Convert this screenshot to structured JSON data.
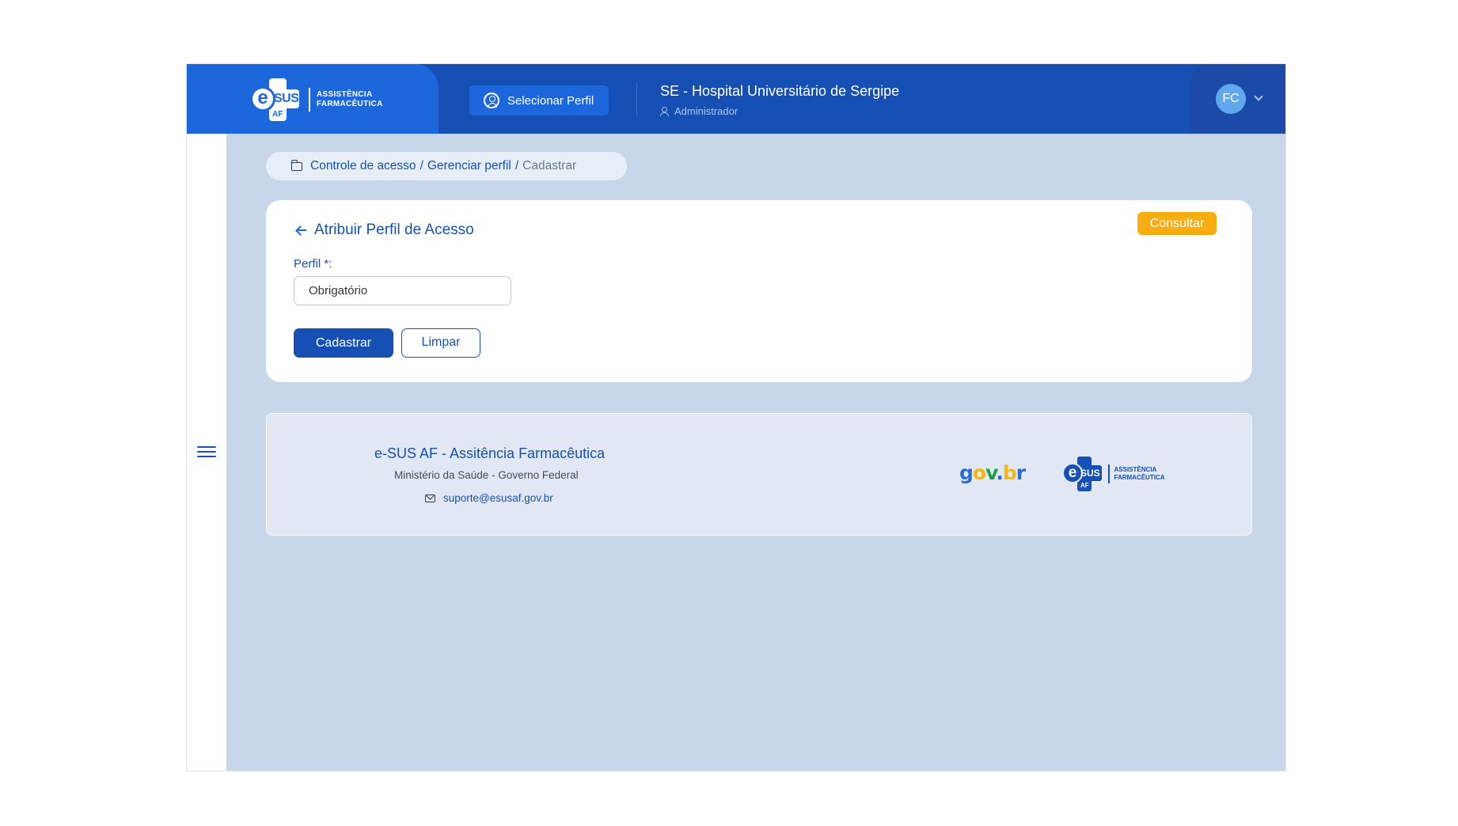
{
  "header": {
    "brand_line1": "ASSISTÊNCIA",
    "brand_line2": "FARMACÊUTICA",
    "logo_e": "e",
    "logo_sus": "SUS",
    "logo_af": "AF",
    "select_profile": "Selecionar Perfil",
    "org_name": "SE - Hospital Universitário de Sergipe",
    "org_role": "Administrador",
    "avatar_initials": "FC"
  },
  "breadcrumb": {
    "items": [
      "Controle de acesso",
      "Gerenciar perfil"
    ],
    "current": "Cadastrar",
    "separator": "/"
  },
  "card": {
    "title": "Atribuir Perfil de Acesso",
    "consultar_label": "Consultar",
    "field_label": "Perfil *:",
    "field_value": "Obrigatório",
    "submit_label": "Cadastrar",
    "clear_label": "Limpar"
  },
  "footer": {
    "title": "e-SUS AF - Assitência Farmacêutica",
    "subtitle": "Ministério da Saúde - Governo Federal",
    "email": "suporte@esusaf.gov.br",
    "gov_logo": [
      "g",
      "o",
      "v",
      ".",
      "b",
      "r"
    ],
    "brand_line1": "ASSISTÊNCIA",
    "brand_line2": "FARMACÊUTICA",
    "logo_e": "e",
    "logo_sus": "SUS",
    "logo_af": "AF"
  },
  "colors": {
    "primary": "#1650b4",
    "brand_blue": "#1d67dd",
    "accent_orange": "#f7ac10",
    "background": "#c8d6ea"
  }
}
